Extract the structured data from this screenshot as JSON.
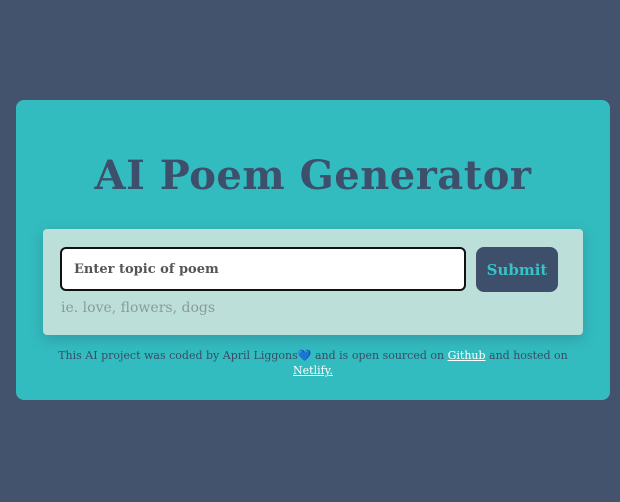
{
  "app": {
    "title": "AI Poem Generator"
  },
  "form": {
    "input_placeholder": "Enter topic of poem",
    "input_value": "",
    "submit_label": "Submit",
    "hint": "ie. love, flowers, dogs"
  },
  "footer": {
    "text_before": "This AI project was coded by April Liggons",
    "heart": "💙",
    "text_middle": " and is open sourced on ",
    "github_label": "Github",
    "text_after": " and hosted on ",
    "netlify_label": "Netlify."
  },
  "colors": {
    "page_background": "#43536d",
    "card_background": "#33bcc0",
    "panel_background": "#bddfd9",
    "accent_dark": "#3e4f6b",
    "accent_teal": "#35c3c6"
  }
}
